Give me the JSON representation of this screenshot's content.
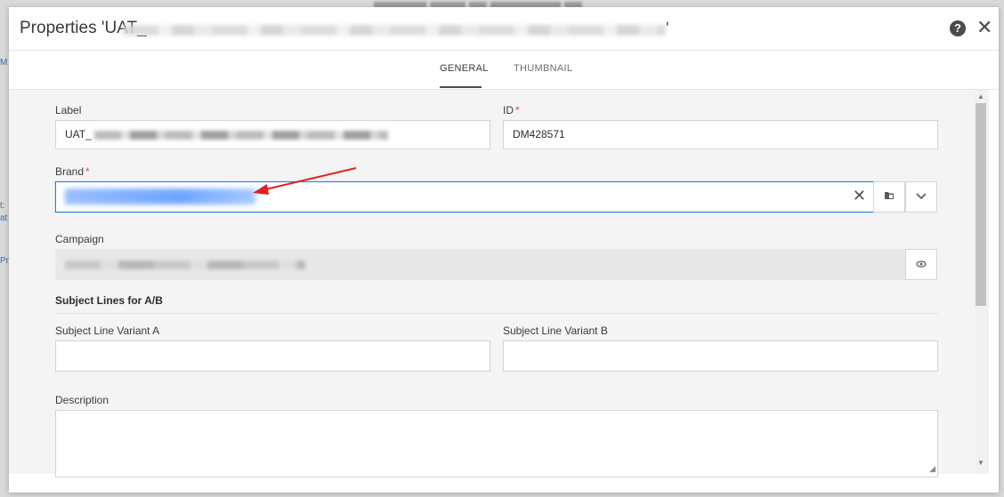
{
  "dialog": {
    "title_prefix": "Properties 'UAT_",
    "title_suffix": "'",
    "help_glyph": "?",
    "close_glyph": "✕"
  },
  "tabs": [
    {
      "label": "GENERAL",
      "active": true
    },
    {
      "label": "THUMBNAIL",
      "active": false
    }
  ],
  "form": {
    "label": {
      "caption": "Label",
      "value": "UAT_"
    },
    "id": {
      "caption": "ID",
      "required_mark": "*",
      "value": "DM428571"
    },
    "brand": {
      "caption": "Brand",
      "required_mark": "*",
      "clear_glyph": "✕"
    },
    "campaign": {
      "caption": "Campaign"
    },
    "subject_section": {
      "title": "Subject Lines for A/B"
    },
    "variant_a": {
      "caption": "Subject Line Variant A",
      "value": ""
    },
    "variant_b": {
      "caption": "Subject Line Variant B",
      "value": ""
    },
    "description": {
      "caption": "Description",
      "value": ""
    }
  },
  "icons": {
    "help": "help-icon",
    "close": "close-icon",
    "clear": "clear-icon",
    "browse": "folder-browse-icon",
    "dropdown": "chevron-down-icon",
    "view": "eye-icon"
  },
  "colors": {
    "focus_border": "#2680eb",
    "required": "#e34850",
    "arrow": "#e02020"
  }
}
